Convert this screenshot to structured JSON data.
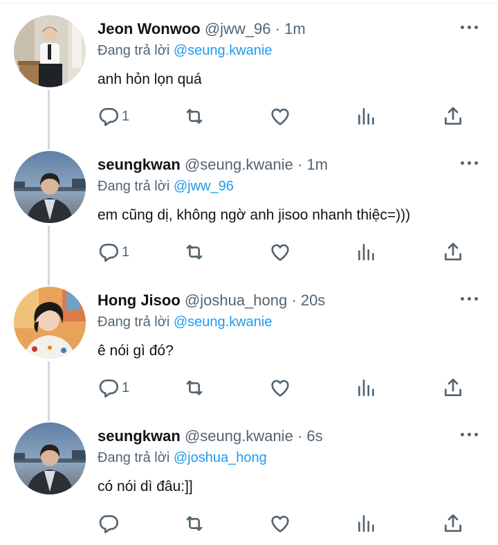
{
  "tweets": [
    {
      "name": "Jeon Wonwoo",
      "handle": "@jww_96",
      "separator": "·",
      "time": "1m",
      "reply_prefix": "Đang trả lời",
      "reply_to": "@seung.kwanie",
      "text": "anh hỏn lọn quá",
      "reply_count": "1",
      "avatar": "wonwoo-photo"
    },
    {
      "name": "seungkwan",
      "handle": "@seung.kwanie",
      "separator": "·",
      "time": "1m",
      "reply_prefix": "Đang trả lời",
      "reply_to": "@jww_96",
      "text": "em cũng dị, không ngờ anh jisoo nhanh thiệc=)))",
      "reply_count": "1",
      "avatar": "seungkwan-photo"
    },
    {
      "name": "Hong Jisoo",
      "handle": "@joshua_hong",
      "separator": "·",
      "time": "20s",
      "reply_prefix": "Đang trả lời",
      "reply_to": "@seung.kwanie",
      "text": "ê nói gì đó?",
      "reply_count": "1",
      "avatar": "jisoo-photo"
    },
    {
      "name": "seungkwan",
      "handle": "@seung.kwanie",
      "separator": "·",
      "time": "6s",
      "reply_prefix": "Đang trả lời",
      "reply_to": "@joshua_hong",
      "text": "có nói dì đâu:]]",
      "reply_count": "",
      "avatar": "seungkwan-photo"
    }
  ],
  "colors": {
    "text": "#0f1419",
    "secondary": "#536471",
    "mention": "#1d9bf0",
    "thread_line": "#cfd9de"
  },
  "icons": [
    "reply-icon",
    "retweet-icon",
    "like-icon",
    "views-icon",
    "share-icon",
    "more-icon"
  ]
}
